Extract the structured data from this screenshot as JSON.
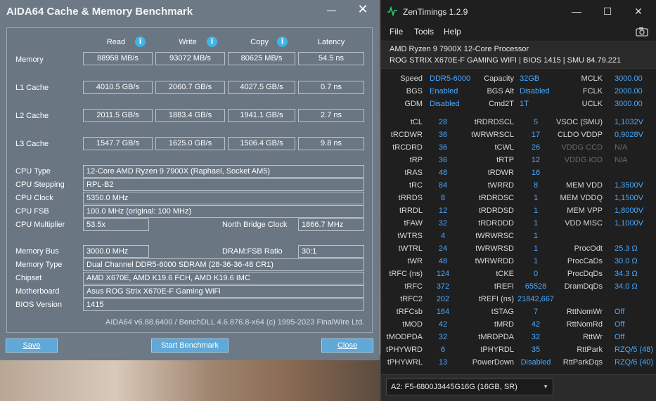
{
  "aida": {
    "title": "AIDA64 Cache & Memory Benchmark",
    "columns": {
      "read": "Read",
      "write": "Write",
      "copy": "Copy",
      "latency": "Latency"
    },
    "rows": [
      {
        "label": "Memory",
        "read": "88958 MB/s",
        "write": "93072 MB/s",
        "copy": "80625 MB/s",
        "latency": "54.5 ns"
      },
      {
        "label": "L1 Cache",
        "read": "4010.5 GB/s",
        "write": "2060.7 GB/s",
        "copy": "4027.5 GB/s",
        "latency": "0.7 ns"
      },
      {
        "label": "L2 Cache",
        "read": "2011.5 GB/s",
        "write": "1883.4 GB/s",
        "copy": "1941.1 GB/s",
        "latency": "2.7 ns"
      },
      {
        "label": "L3 Cache",
        "read": "1547.7 GB/s",
        "write": "1625.0 GB/s",
        "copy": "1506.4 GB/s",
        "latency": "9.8 ns"
      }
    ],
    "info": {
      "cpu_type": {
        "label": "CPU Type",
        "value": "12-Core AMD Ryzen 9 7900X  (Raphael, Socket AM5)"
      },
      "cpu_stepping": {
        "label": "CPU Stepping",
        "value": "RPL-B2"
      },
      "cpu_clock": {
        "label": "CPU Clock",
        "value": "5350.0 MHz"
      },
      "cpu_fsb": {
        "label": "CPU FSB",
        "value": "100.0 MHz  (original: 100 MHz)"
      },
      "cpu_multiplier": {
        "label": "CPU Multiplier",
        "value": "53.5x"
      },
      "north_bridge_clock": {
        "label": "North Bridge Clock",
        "value": "1866.7 MHz"
      },
      "memory_bus": {
        "label": "Memory Bus",
        "value": "3000.0 MHz"
      },
      "dram_fsb_ratio": {
        "label": "DRAM:FSB Ratio",
        "value": "30:1"
      },
      "memory_type": {
        "label": "Memory Type",
        "value": "Dual Channel DDR5-6000 SDRAM  (28-36-36-48 CR1)"
      },
      "chipset": {
        "label": "Chipset",
        "value": "AMD X670E, AMD K19.6 FCH, AMD K19.6 IMC"
      },
      "motherboard": {
        "label": "Motherboard",
        "value": "Asus ROG Strix X670E-F Gaming WiFi"
      },
      "bios_version": {
        "label": "BIOS Version",
        "value": "1415"
      }
    },
    "footer": "AIDA64 v6.88.6400 / BenchDLL 4.6.876.8-x64  (c) 1995-2023 FinalWire Ltd.",
    "buttons": {
      "save": "Save",
      "start": "Start Benchmark",
      "close": "Close"
    }
  },
  "zen": {
    "title": "ZenTimings 1.2.9",
    "menu": {
      "file": "File",
      "tools": "Tools",
      "help": "Help"
    },
    "cpu": "AMD Ryzen 9 7900X 12-Core Processor",
    "board": "ROG STRIX X670E-F GAMING WIFI | BIOS 1415 | SMU 84.79.221",
    "top": [
      [
        {
          "l": "Speed",
          "v": "DDR5-6000"
        },
        {
          "l": "Capacity",
          "v": "32GB"
        },
        {
          "l": "MCLK",
          "v": "3000.00"
        }
      ],
      [
        {
          "l": "BGS",
          "v": "Enabled"
        },
        {
          "l": "BGS Alt",
          "v": "Disabled"
        },
        {
          "l": "FCLK",
          "v": "2000.00"
        }
      ],
      [
        {
          "l": "GDM",
          "v": "Disabled"
        },
        {
          "l": "Cmd2T",
          "v": "1T"
        },
        {
          "l": "UCLK",
          "v": "3000.00"
        }
      ]
    ],
    "timings": [
      [
        {
          "l": "tCL",
          "v": "28"
        },
        {
          "l": "tRDRDSCL",
          "v": "5"
        },
        {
          "l": "VSOC (SMU)",
          "v": "1,1032V"
        }
      ],
      [
        {
          "l": "tRCDWR",
          "v": "36"
        },
        {
          "l": "tWRWRSCL",
          "v": "17"
        },
        {
          "l": "CLDO VDDP",
          "v": "0,9028V"
        }
      ],
      [
        {
          "l": "tRCDRD",
          "v": "36"
        },
        {
          "l": "tCWL",
          "v": "26"
        },
        {
          "l": "VDDG CCD",
          "v": "N/A",
          "dim": true
        }
      ],
      [
        {
          "l": "tRP",
          "v": "36"
        },
        {
          "l": "tRTP",
          "v": "12"
        },
        {
          "l": "VDDG IOD",
          "v": "N/A",
          "dim": true
        }
      ],
      [
        {
          "l": "tRAS",
          "v": "48"
        },
        {
          "l": "tRDWR",
          "v": "16"
        },
        {
          "l": "",
          "v": ""
        }
      ],
      [
        {
          "l": "tRC",
          "v": "84"
        },
        {
          "l": "tWRRD",
          "v": "8"
        },
        {
          "l": "MEM VDD",
          "v": "1,3500V"
        }
      ],
      [
        {
          "l": "tRRDS",
          "v": "8"
        },
        {
          "l": "tRDRDSC",
          "v": "1"
        },
        {
          "l": "MEM VDDQ",
          "v": "1,1500V"
        }
      ],
      [
        {
          "l": "tRRDL",
          "v": "12"
        },
        {
          "l": "tRDRDSD",
          "v": "1"
        },
        {
          "l": "MEM VPP",
          "v": "1,8000V"
        }
      ],
      [
        {
          "l": "tFAW",
          "v": "32"
        },
        {
          "l": "tRDRDDD",
          "v": "1"
        },
        {
          "l": "VDD MISC",
          "v": "1,1000V"
        }
      ],
      [
        {
          "l": "tWTRS",
          "v": "4"
        },
        {
          "l": "tWRWRSC",
          "v": "1"
        },
        {
          "l": "",
          "v": ""
        }
      ],
      [
        {
          "l": "tWTRL",
          "v": "24"
        },
        {
          "l": "tWRWRSD",
          "v": "1"
        },
        {
          "l": "ProcOdt",
          "v": "25.3 Ω"
        }
      ],
      [
        {
          "l": "tWR",
          "v": "48"
        },
        {
          "l": "tWRWRDD",
          "v": "1"
        },
        {
          "l": "ProcCaDs",
          "v": "30.0 Ω"
        }
      ],
      [
        {
          "l": "tRFC (ns)",
          "v": "124"
        },
        {
          "l": "tCKE",
          "v": "0"
        },
        {
          "l": "ProcDqDs",
          "v": "34.3 Ω"
        }
      ],
      [
        {
          "l": "tRFC",
          "v": "372"
        },
        {
          "l": "tREFI",
          "v": "65528"
        },
        {
          "l": "DramDqDs",
          "v": "34.0 Ω"
        }
      ],
      [
        {
          "l": "tRFC2",
          "v": "202"
        },
        {
          "l": "tREFI (ns)",
          "v": "21842,667"
        },
        {
          "l": "",
          "v": ""
        }
      ],
      [
        {
          "l": "tRFCsb",
          "v": "164"
        },
        {
          "l": "tSTAG",
          "v": "7"
        },
        {
          "l": "RttNomWr",
          "v": "Off"
        }
      ],
      [
        {
          "l": "tMOD",
          "v": "42"
        },
        {
          "l": "tMRD",
          "v": "42"
        },
        {
          "l": "RttNomRd",
          "v": "Off"
        }
      ],
      [
        {
          "l": "tMODPDA",
          "v": "32"
        },
        {
          "l": "tMRDPDA",
          "v": "32"
        },
        {
          "l": "RttWr",
          "v": "Off"
        }
      ],
      [
        {
          "l": "tPHYWRD",
          "v": "6"
        },
        {
          "l": "tPHYRDL",
          "v": "35"
        },
        {
          "l": "RttPark",
          "v": "RZQ/5 (48)"
        }
      ],
      [
        {
          "l": "tPHYWRL",
          "v": "13"
        },
        {
          "l": "PowerDown",
          "v": "Disabled"
        },
        {
          "l": "RttParkDqs",
          "v": "RZQ/6 (40)"
        }
      ]
    ],
    "dimm_select": "A2: F5-6800J3445G16G (16GB, SR)"
  }
}
